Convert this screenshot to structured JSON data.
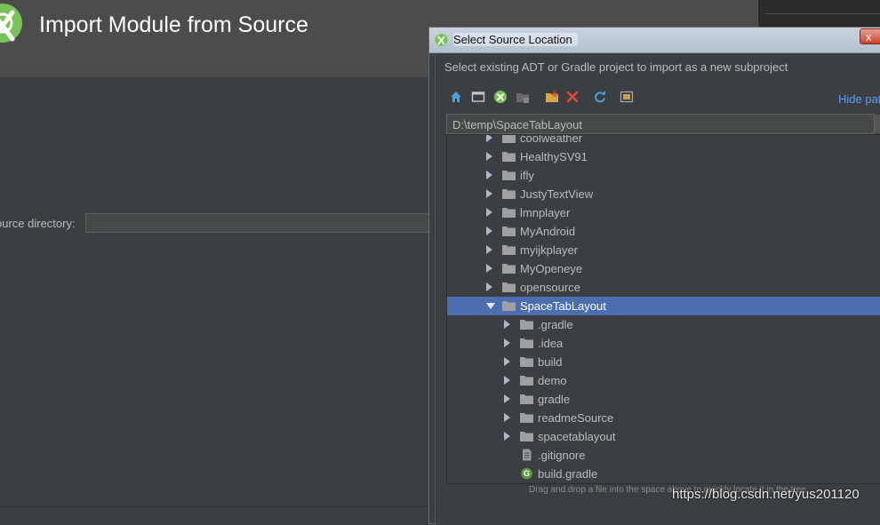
{
  "wizard": {
    "title": "Import Module from Source",
    "source_label": "ource directory:",
    "source_value": ""
  },
  "dialog": {
    "title": "Select Source Location",
    "close_label": "x",
    "description": "Select existing ADT or Gradle project to import as a new subproject",
    "hide_path_label": "Hide pat",
    "path_value": "D:\\temp\\SpaceTabLayout",
    "toolbar": [
      {
        "name": "home-icon"
      },
      {
        "name": "desktop-icon"
      },
      {
        "name": "project-icon"
      },
      {
        "name": "module-icon"
      },
      {
        "name": "new-folder-icon"
      },
      {
        "name": "delete-icon"
      },
      {
        "name": "refresh-icon"
      },
      {
        "name": "show-hidden-icon"
      }
    ],
    "tree": [
      {
        "label": "coolweather",
        "level": 0,
        "type": "folder",
        "expanded": false,
        "selected": false
      },
      {
        "label": "HealthySV91",
        "level": 0,
        "type": "folder",
        "expanded": false,
        "selected": false
      },
      {
        "label": "ifly",
        "level": 0,
        "type": "folder",
        "expanded": false,
        "selected": false
      },
      {
        "label": "JustyTextView",
        "level": 0,
        "type": "folder",
        "expanded": false,
        "selected": false
      },
      {
        "label": "lmnplayer",
        "level": 0,
        "type": "folder",
        "expanded": false,
        "selected": false
      },
      {
        "label": "MyAndroid",
        "level": 0,
        "type": "folder",
        "expanded": false,
        "selected": false
      },
      {
        "label": "myijkplayer",
        "level": 0,
        "type": "folder",
        "expanded": false,
        "selected": false
      },
      {
        "label": "MyOpeneye",
        "level": 0,
        "type": "folder",
        "expanded": false,
        "selected": false
      },
      {
        "label": "opensource",
        "level": 0,
        "type": "folder",
        "expanded": false,
        "selected": false
      },
      {
        "label": "SpaceTabLayout",
        "level": 0,
        "type": "folder",
        "expanded": true,
        "selected": true
      },
      {
        "label": ".gradle",
        "level": 1,
        "type": "folder",
        "expanded": false,
        "selected": false
      },
      {
        "label": ".idea",
        "level": 1,
        "type": "folder",
        "expanded": false,
        "selected": false
      },
      {
        "label": "build",
        "level": 1,
        "type": "folder",
        "expanded": false,
        "selected": false
      },
      {
        "label": "demo",
        "level": 1,
        "type": "folder",
        "expanded": false,
        "selected": false
      },
      {
        "label": "gradle",
        "level": 1,
        "type": "folder",
        "expanded": false,
        "selected": false
      },
      {
        "label": "readmeSource",
        "level": 1,
        "type": "folder",
        "expanded": false,
        "selected": false
      },
      {
        "label": "spacetablayout",
        "level": 1,
        "type": "folder",
        "expanded": false,
        "selected": false
      },
      {
        "label": ".gitignore",
        "level": 1,
        "type": "file",
        "expanded": false,
        "selected": false
      },
      {
        "label": "build.gradle",
        "level": 1,
        "type": "gradle",
        "expanded": false,
        "selected": false
      }
    ],
    "hint": "Drag and drop a file into the space above to quickly locate it in the tree"
  },
  "watermark": "https://blog.csdn.net/yus201120",
  "colors": {
    "background": "#3c3f41",
    "header": "#4c4c4c",
    "selection": "#4b6eaf",
    "link": "#589df6",
    "android_green": "#78c257"
  }
}
